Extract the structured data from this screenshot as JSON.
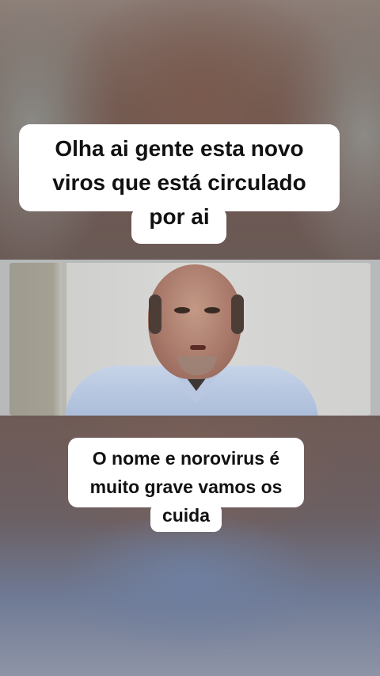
{
  "captions": {
    "top": {
      "lines": [
        "Olha ai gente esta novo",
        "viros que está circulado",
        "por ai"
      ]
    },
    "bottom": {
      "lines": [
        "O nome e norovirus é",
        "muito grave vamos os",
        "cuida"
      ]
    }
  },
  "colors": {
    "caption_bg": "#ffffff",
    "caption_text": "#111111"
  }
}
